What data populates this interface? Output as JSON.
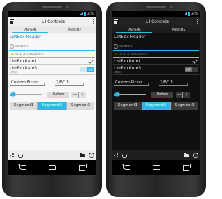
{
  "statusbar": {
    "time": "3:59"
  },
  "actionbar": {
    "title": "UI Controls",
    "delete_icon": "trash-icon",
    "overflow_icon": "overflow-menu-icon"
  },
  "tabs": [
    {
      "label": "TABITEM1",
      "active": true
    },
    {
      "label": "TABITEM2",
      "active": false
    }
  ],
  "listbox": {
    "header": "ListBox Header",
    "search_placeholder": "search",
    "group_header": "LISTBOXGROUPHEADER1",
    "item1": {
      "label": "ListBoxItem1",
      "checked": true
    },
    "item3": {
      "label": "ListBoxItem3",
      "detail": "Detail"
    }
  },
  "light": {
    "toggle_label": "ON"
  },
  "dark": {
    "toggle_label": "OFF"
  },
  "controls": {
    "picker_label": "Custom Picker",
    "date_value": "2/8/13",
    "button_label": "Button",
    "stepper_minus": "—",
    "stepper_plus": "+",
    "slider_fraction": 0.1
  },
  "segments": [
    {
      "label": "Segment1",
      "selected": false
    },
    {
      "label": "Segment2",
      "selected": true
    },
    {
      "label": "Segment3",
      "selected": false
    }
  ],
  "bottombar": {
    "icons": [
      "share-icon",
      "refresh-icon",
      "folder-icon",
      "info-icon"
    ]
  },
  "navbar": {
    "icons": [
      "back-icon",
      "home-icon",
      "recent-apps-icon"
    ]
  },
  "colors": {
    "accent": "#33b5e5",
    "light_bg": "#f7f7f7",
    "dark_bg": "#101010"
  }
}
